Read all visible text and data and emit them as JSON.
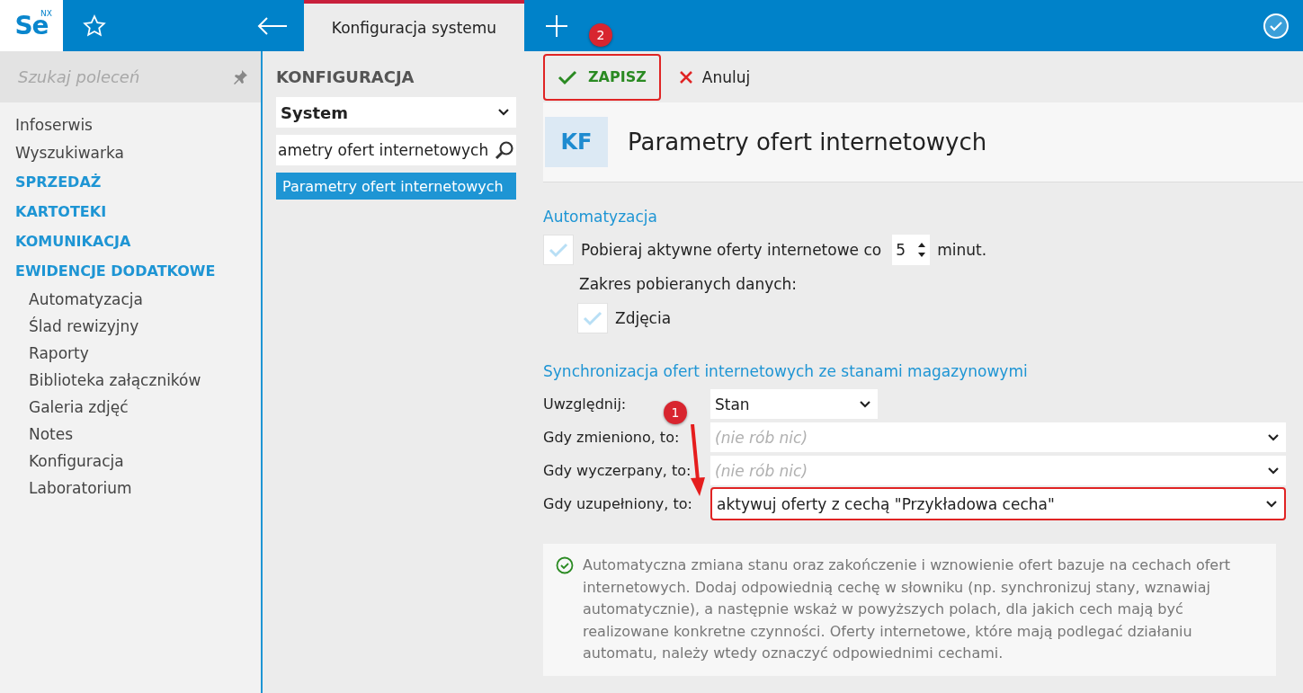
{
  "app": {
    "logo": "Se",
    "logo_sup": "NX"
  },
  "tab": {
    "title": "Konfiguracja systemu",
    "selected": true
  },
  "sidebar": {
    "search_placeholder": "Szukaj poleceń",
    "items": [
      {
        "label": "Infoserwis",
        "kind": "link"
      },
      {
        "label": "Wyszukiwarka",
        "kind": "link"
      },
      {
        "label": "SPRZEDAŻ",
        "kind": "group"
      },
      {
        "label": "KARTOTEKI",
        "kind": "group"
      },
      {
        "label": "KOMUNIKACJA",
        "kind": "group"
      },
      {
        "label": "EWIDENCJE DODATKOWE",
        "kind": "group",
        "children": [
          {
            "label": "Automatyzacja"
          },
          {
            "label": "Ślad rewizyjny"
          },
          {
            "label": "Raporty"
          },
          {
            "label": "Biblioteka załączników"
          },
          {
            "label": "Galeria zdjęć"
          },
          {
            "label": "Notes"
          },
          {
            "label": "Konfiguracja"
          },
          {
            "label": "Laboratorium"
          }
        ]
      }
    ]
  },
  "config_panel": {
    "title": "KONFIGURACJA",
    "category": "System",
    "search_value": "ametry ofert internetowych",
    "results": [
      {
        "label": "Parametry ofert internetowych",
        "selected": true
      }
    ]
  },
  "toolbar": {
    "save": "ZAPISZ",
    "cancel": "Anuluj"
  },
  "header": {
    "badge": "KF",
    "title": "Parametry ofert internetowych"
  },
  "automation": {
    "title": "Automatyzacja",
    "fetch": {
      "checked": true,
      "label": "Pobieraj aktywne oferty internetowe co",
      "value": "5",
      "unit": "minut."
    },
    "scope_label": "Zakres pobieranych danych:",
    "photos": {
      "checked": true,
      "label": "Zdjęcia"
    }
  },
  "sync": {
    "title": "Synchronizacja ofert internetowych ze stanami magazynowymi",
    "fields": [
      {
        "label": "Uwzględnij:",
        "value": "Stan",
        "kind": "short",
        "highlighted": false
      },
      {
        "label": "Gdy zmieniono, to:",
        "placeholder": "(nie rób nic)",
        "kind": "wide",
        "highlighted": false
      },
      {
        "label": "Gdy wyczerpany, to:",
        "placeholder": "(nie rób nic)",
        "kind": "wide",
        "highlighted": false
      },
      {
        "label": "Gdy uzupełniony, to:",
        "value": "aktywuj oferty z cechą \"Przykładowa cecha\"",
        "kind": "wide",
        "highlighted": true
      }
    ]
  },
  "info": "Automatyczna zmiana stanu oraz zakończenie i wznowienie ofert bazuje na cechach ofert internetowych. Dodaj odpowiednią cechę w słowniku (np. synchronizuj stany, wznawiaj automatycznie), a następnie wskaż w powyższych polach, dla jakich cech mają być realizowane konkretne czynności. Oferty internetowe, które mają podlegać działaniu automatu, należy wtedy oznaczyć odpowiednimi cechami.",
  "annotations": [
    {
      "number": "2"
    },
    {
      "number": "1"
    }
  ]
}
